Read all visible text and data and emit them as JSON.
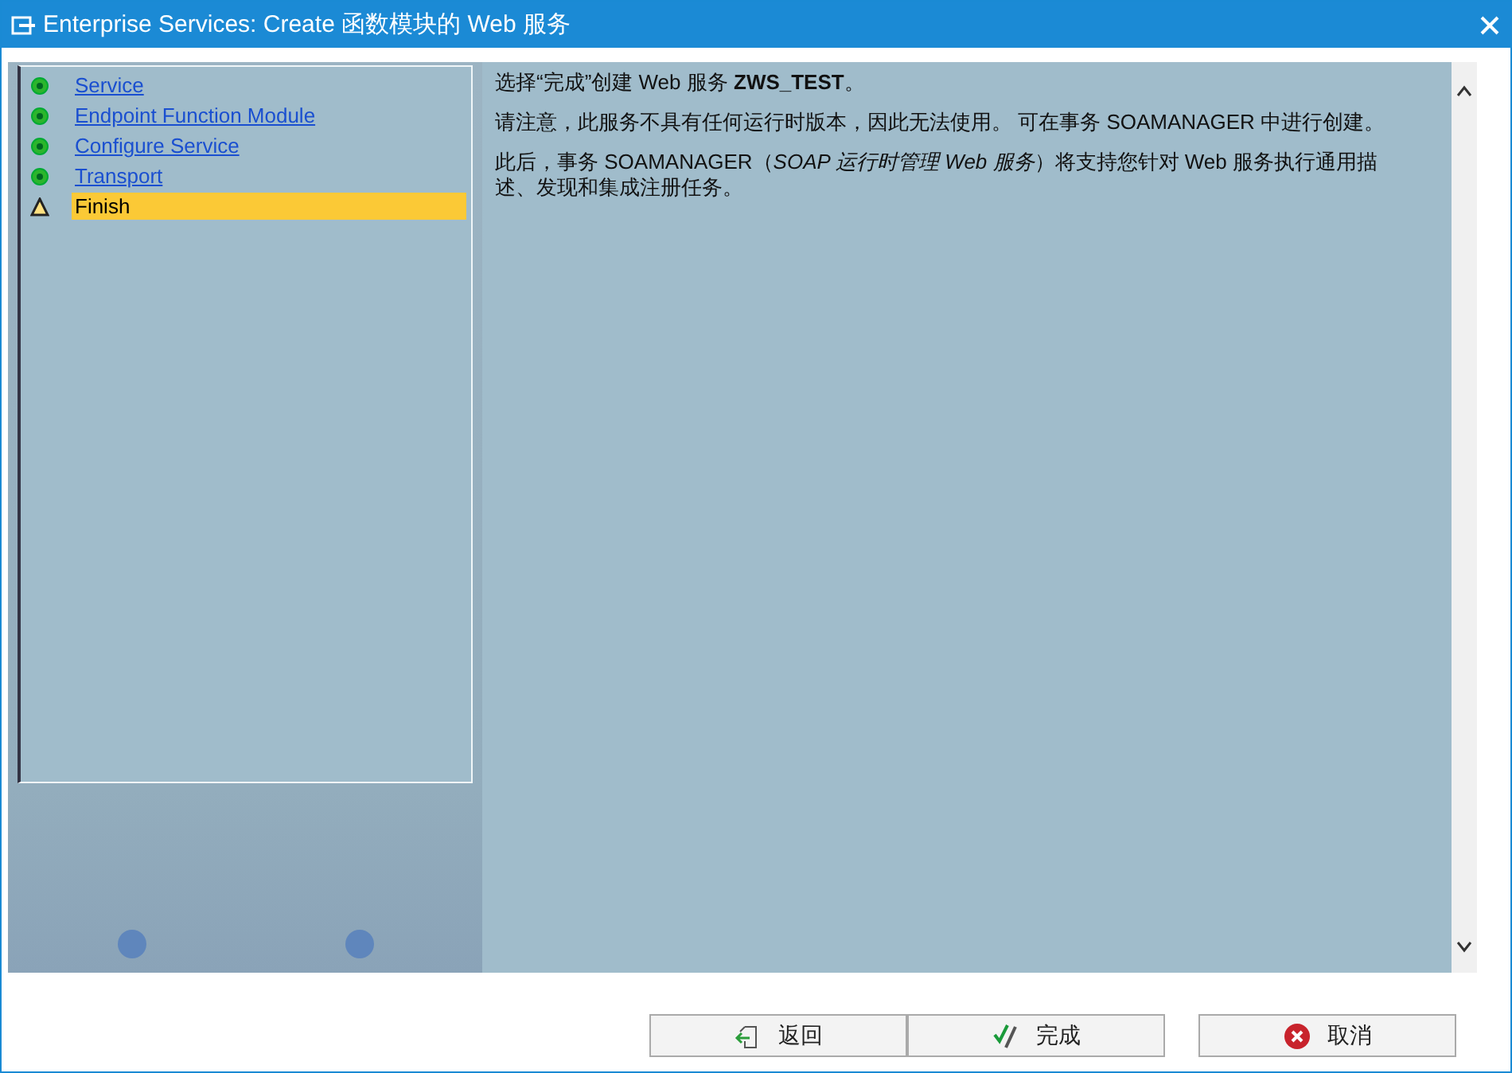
{
  "window": {
    "title": "Enterprise Services: Create 函数模块的 Web 服务"
  },
  "steps": [
    {
      "label": "Service",
      "kind": "done",
      "selected": false
    },
    {
      "label": "Endpoint Function Module",
      "kind": "done",
      "selected": false
    },
    {
      "label": "Configure Service",
      "kind": "done",
      "selected": false
    },
    {
      "label": "Transport",
      "kind": "done",
      "selected": false
    },
    {
      "label": "Finish",
      "kind": "warning",
      "selected": true
    }
  ],
  "content": {
    "paragraphs": [
      "选择“完成”创建 Web 服务 **ZWS_TEST**。",
      "请注意，此服务不具有任何运行时版本，因此无法使用。 可在事务 SOAMANAGER 中进行创建。",
      "此后，事务 SOAMANAGER（*SOAP 运行时管理 Web 服务*）将支持您针对 Web 服务执行通用描述、发现和集成注册任务。"
    ]
  },
  "buttons": [
    {
      "kind": "back",
      "label": "返回"
    },
    {
      "kind": "finish",
      "label": "完成"
    },
    {
      "kind": "cancel",
      "label": "取消"
    }
  ]
}
